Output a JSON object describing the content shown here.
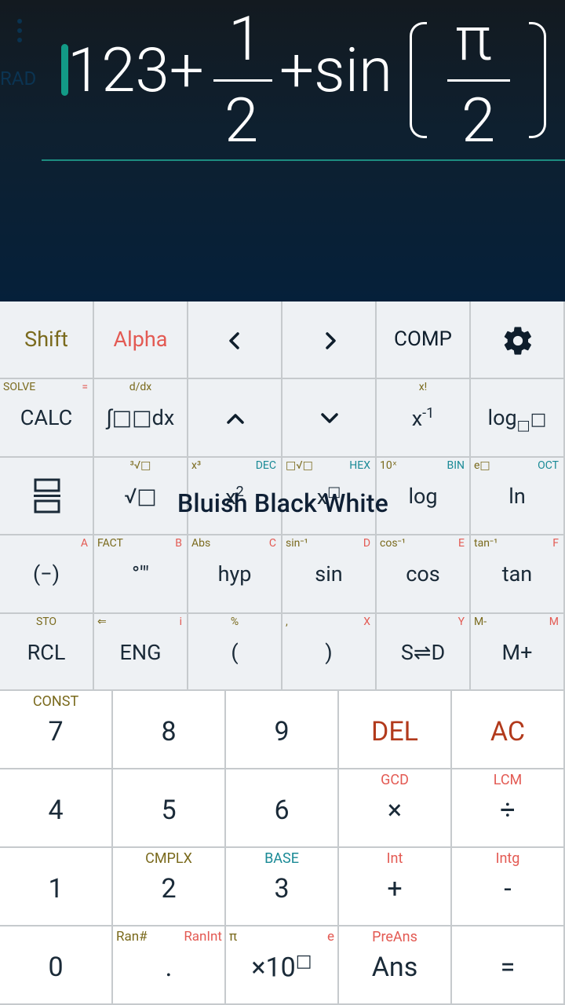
{
  "display": {
    "mode": "RAD",
    "expression": {
      "p1": "123+",
      "num1": "1",
      "den1": "2",
      "p2": "+sin",
      "num2": "π",
      "den2": "2"
    },
    "overlay": "Bluish Black White"
  },
  "keys": {
    "shift": "Shift",
    "alpha": "Alpha",
    "left": "<",
    "right": ">",
    "comp": "COMP",
    "settings": "settings",
    "calc": "CALC",
    "calc_sup_l": "SOLVE",
    "calc_sup_r": "=",
    "integ": "∫□□dx",
    "integ_sup": "d/dx",
    "up": "^",
    "down": "v",
    "xinv": "x",
    "xinv_exp": "-1",
    "xinv_sup": "x!",
    "logb": "log",
    "logb_sub": "□",
    "logb_box": "□",
    "frac": "frac",
    "sqrt": "√□",
    "sqrt_sup": "³√□",
    "sq": "x",
    "sq_exp": "2",
    "sq_sup_l": "x³",
    "sq_sup_r": "DEC",
    "pow": "x",
    "pow_exp": "□",
    "pow_sup_l": "□√□",
    "pow_sup_r": "HEX",
    "log": "log",
    "log_sup_l": "10ˣ",
    "log_sup_r": "BIN",
    "ln": "ln",
    "ln_sup_l": "e□",
    "ln_sup_r": "OCT",
    "neg": "(−)",
    "neg_sup_r": "A",
    "deg": "°'\"",
    "deg_sup_l": "FACT",
    "deg_sup_r": "B",
    "hyp": "hyp",
    "hyp_sup_l": "Abs",
    "hyp_sup_r": "C",
    "sin": "sin",
    "sin_sup_l": "sin⁻¹",
    "sin_sup_r": "D",
    "cos": "cos",
    "cos_sup_l": "cos⁻¹",
    "cos_sup_r": "E",
    "tan": "tan",
    "tan_sup_l": "tan⁻¹",
    "tan_sup_r": "F",
    "rcl": "RCL",
    "rcl_sup": "STO",
    "eng": "ENG",
    "eng_sup_l": "⇐",
    "eng_sup_r": "i",
    "lp": "(",
    "lp_sup": "%",
    "rp": ")",
    "rp_sup_l": ",",
    "rp_sup_r": "X",
    "sd": "S⇌D",
    "sd_sup_r": "Y",
    "mplus": "M+",
    "mplus_sup_l": "M-",
    "mplus_sup_r": "M",
    "n7": "7",
    "n7_sup": "CONST",
    "n8": "8",
    "n9": "9",
    "del": "DEL",
    "ac": "AC",
    "n4": "4",
    "n5": "5",
    "n6": "6",
    "mul": "×",
    "mul_sup": "GCD",
    "div": "÷",
    "div_sup": "LCM",
    "n1": "1",
    "n2": "2",
    "n2_sup": "CMPLX",
    "n3": "3",
    "n3_sup": "BASE",
    "plus": "+",
    "plus_sup": "Int",
    "minus": "-",
    "minus_sup": "Intg",
    "n0": "0",
    "dot": ".",
    "dot_sup_l": "Ran#",
    "dot_sup_r": "RanInt",
    "exp": "×10",
    "exp_box": "□",
    "exp_sup_l": "π",
    "exp_sup_r": "e",
    "ans": "Ans",
    "ans_sup": "PreAns",
    "eq": "="
  }
}
